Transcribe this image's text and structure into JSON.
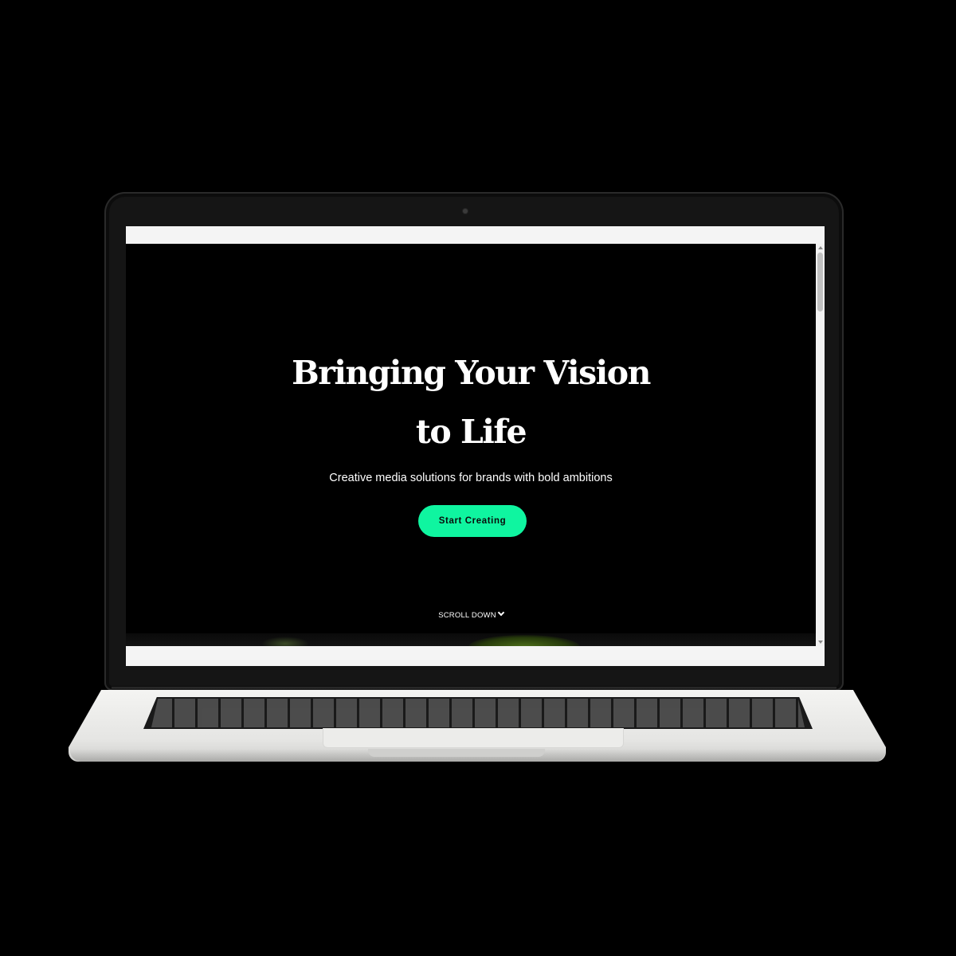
{
  "hero": {
    "title_line1": "Bringing Your Vision",
    "title_line2": "to Life",
    "subtitle": "Creative media solutions for brands with bold ambitions",
    "cta_label": "Start Creating",
    "scroll_label": "SCROLL DOWN"
  },
  "icons": {
    "scroll_indicator": "chevron-down-icon",
    "camera": "webcam-dot"
  },
  "colors": {
    "background": "#000000",
    "text": "#ffffff",
    "cta_accent": "#0ff5a0",
    "cta_text": "#0a0a0a"
  }
}
